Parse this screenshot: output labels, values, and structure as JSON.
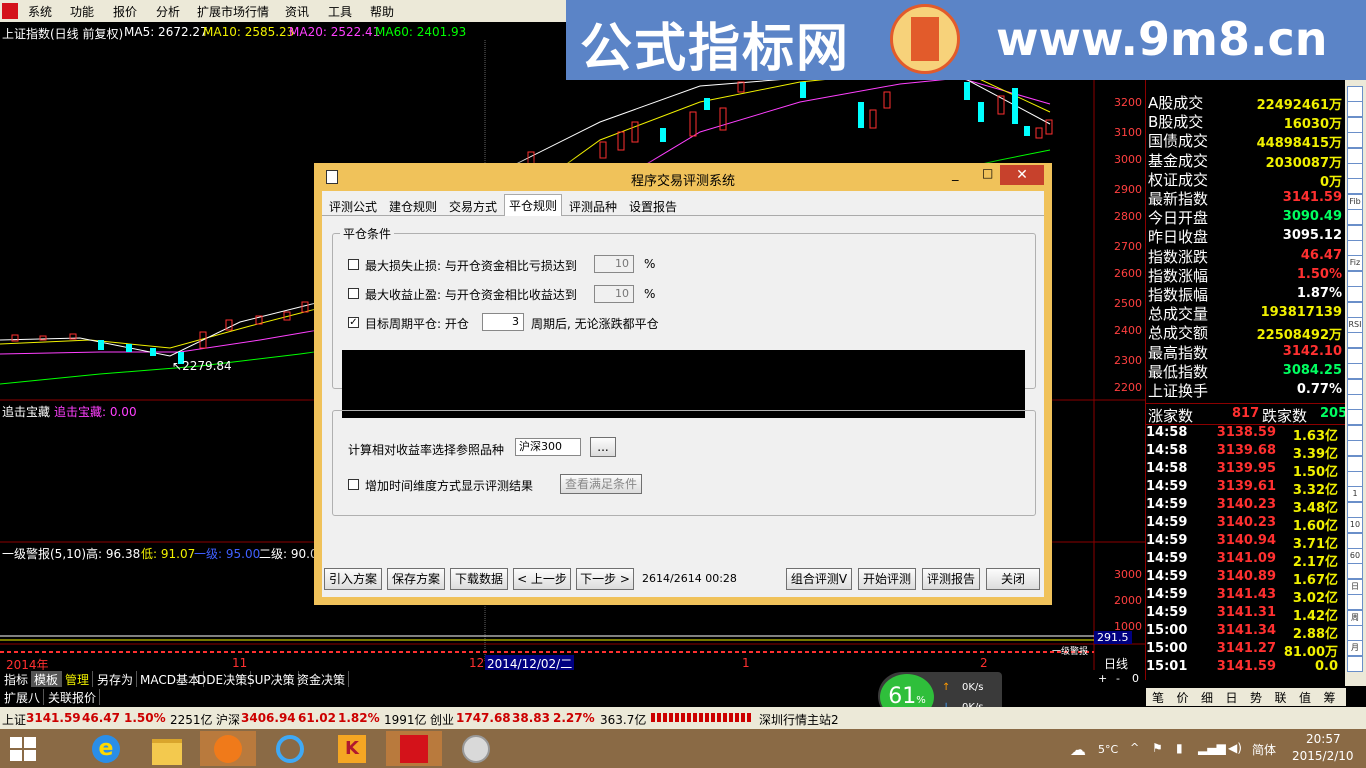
{
  "menubar": {
    "items": [
      "系统",
      "功能",
      "报价",
      "分析",
      "扩展市场行情",
      "资讯",
      "工具",
      "帮助"
    ]
  },
  "banner": {
    "text": "公式指标网",
    "url": "www.9m8.cn"
  },
  "chart": {
    "title": "上证指数(日线 前复权)",
    "ma5": "MA5: 2672.27",
    "ma10": "MA10: 2585.23",
    "ma20": "MA20: 2522.41",
    "ma60": "MA60: 2401.93",
    "low_marker": "2279.84",
    "price_axis": [
      "3200",
      "3100",
      "3000",
      "2900",
      "2800",
      "2700",
      "2600",
      "2500",
      "2400",
      "2300",
      "2200"
    ],
    "lower_axis": [
      "3000",
      "2000",
      "1000"
    ],
    "indicator1_name": "追击宝藏",
    "indicator1_value": "追击宝藏: 0.00",
    "indicator2_name": "一级警报(5,10)",
    "indicator2_high": "高: 96.38",
    "indicator2_low": "低: 91.07",
    "indicator2_l1": "一级: 95.00",
    "indicator2_l2": "二级: 90.0",
    "vol_label": "291.5",
    "level_tag": "一级警报",
    "time_axis": [
      "2014年",
      "11",
      "12",
      "2014/12/02/二",
      "1",
      "2"
    ],
    "period": "日线",
    "colors": {
      "ma5": "#ffffff",
      "ma10": "#f0f000",
      "ma20": "#ff40ff",
      "ma60": "#00ff00",
      "up": "#ff3030",
      "down": "#00ffff"
    }
  },
  "right_panel": {
    "stats": [
      {
        "label": "A股成交",
        "value": "22492461万",
        "color": "yel"
      },
      {
        "label": "B股成交",
        "value": "16030万",
        "color": "yel"
      },
      {
        "label": "国债成交",
        "value": "44898415万",
        "color": "yel"
      },
      {
        "label": "基金成交",
        "value": "2030087万",
        "color": "yel"
      },
      {
        "label": "权证成交",
        "value": "0万",
        "color": "yel"
      },
      {
        "label": "最新指数",
        "value": "3141.59",
        "color": "red"
      },
      {
        "label": "今日开盘",
        "value": "3090.49",
        "color": "grn"
      },
      {
        "label": "昨日收盘",
        "value": "3095.12",
        "color": "wht"
      },
      {
        "label": "指数涨跌",
        "value": "46.47",
        "color": "red"
      },
      {
        "label": "指数涨幅",
        "value": "1.50%",
        "color": "red"
      },
      {
        "label": "指数振幅",
        "value": "1.87%",
        "color": "wht"
      },
      {
        "label": "总成交量",
        "value": "193817139",
        "color": "yel"
      },
      {
        "label": "总成交额",
        "value": "22508492万",
        "color": "yel"
      },
      {
        "label": "最高指数",
        "value": "3142.10",
        "color": "red"
      },
      {
        "label": "最低指数",
        "value": "3084.25",
        "color": "grn"
      },
      {
        "label": "上证换手",
        "value": "0.77%",
        "color": "wht"
      }
    ],
    "rise_label": "涨家数",
    "rise_count": "817",
    "fall_label": "跌家数",
    "fall_count": "205",
    "ticks": [
      {
        "time": "14:58",
        "price": "3138.59",
        "vol": "1.63亿"
      },
      {
        "time": "14:58",
        "price": "3139.68",
        "vol": "3.39亿"
      },
      {
        "time": "14:58",
        "price": "3139.95",
        "vol": "1.50亿"
      },
      {
        "time": "14:59",
        "price": "3139.61",
        "vol": "3.32亿"
      },
      {
        "time": "14:59",
        "price": "3140.23",
        "vol": "3.48亿"
      },
      {
        "time": "14:59",
        "price": "3140.23",
        "vol": "1.60亿"
      },
      {
        "time": "14:59",
        "price": "3140.94",
        "vol": "3.71亿"
      },
      {
        "time": "14:59",
        "price": "3141.09",
        "vol": "2.17亿"
      },
      {
        "time": "14:59",
        "price": "3140.89",
        "vol": "1.67亿"
      },
      {
        "time": "14:59",
        "price": "3141.43",
        "vol": "3.02亿"
      },
      {
        "time": "14:59",
        "price": "3141.31",
        "vol": "1.42亿"
      },
      {
        "time": "15:00",
        "price": "3141.34",
        "vol": "2.88亿"
      },
      {
        "time": "15:00",
        "price": "3141.27",
        "vol": "81.00万"
      },
      {
        "time": "15:01",
        "price": "3141.59",
        "vol": "0.0"
      }
    ],
    "bottom_tabs": [
      "笔",
      "价",
      "细",
      "日",
      "势",
      "联",
      "值",
      "筹"
    ]
  },
  "right_toolbar": {
    "labels": [
      "",
      "",
      "",
      "",
      "",
      "",
      "",
      "Fib",
      "",
      "",
      "",
      "Fiz",
      "",
      "",
      "",
      "RSI",
      "",
      "",
      "",
      "",
      "",
      "",
      "",
      "",
      "",
      "",
      "1",
      "",
      "10",
      "",
      "60",
      "",
      "日",
      "",
      "周",
      "",
      "月",
      ""
    ]
  },
  "bottom_tabs": {
    "row1": [
      "指标",
      "模板",
      "管理",
      "另存为",
      "MACD基本",
      "DDE决策",
      "SUP决策",
      "资金决策"
    ],
    "row2": [
      "扩展八",
      "关联报价"
    ],
    "corner": [
      "+",
      "-",
      "0"
    ]
  },
  "status_bar": {
    "sh_name": "上证",
    "sh_price": "3141.59",
    "sh_change": "46.47",
    "sh_pct": "1.50%",
    "sh_amount": "2251亿",
    "sz_name": "沪深",
    "sz_price": "3406.94",
    "sz_change": "61.02",
    "sz_pct": "1.82%",
    "sz_amount": "1991亿",
    "cy_name": "创业",
    "cy_price": "1747.68",
    "cy_change": "38.83",
    "cy_pct": "2.27%",
    "cy_amount": "363.7亿",
    "server": "深圳行情主站2"
  },
  "speed_widget": {
    "percent": "61",
    "pct_sign": "%",
    "up": "0K/s",
    "down": "0K/s"
  },
  "taskbar": {
    "weather": "5°C",
    "ime": "简体",
    "time": "20:57",
    "date": "2015/2/10"
  },
  "dialog": {
    "title": "程序交易评测系统",
    "minimize": "_",
    "maximize": "□",
    "close": "✕",
    "tabs": [
      "评测公式",
      "建仓规则",
      "交易方式",
      "平仓规则",
      "评测品种",
      "设置报告"
    ],
    "active_tab": 3,
    "group1_label": "平仓条件",
    "stop_loss_label": "最大损失止损: 与开仓资金相比亏损达到",
    "stop_loss_value": "10",
    "stop_loss_unit": "%",
    "take_profit_label": "最大收益止盈: 与开仓资金相比收益达到",
    "take_profit_value": "10",
    "take_profit_unit": "%",
    "period_label": "目标周期平仓: 开仓",
    "period_value": "3",
    "period_suffix": "周期后, 无论涨跌都平仓",
    "period_checked": "✓",
    "benchmark_label": "计算相对收益率选择参照品种",
    "benchmark_value": "沪深300",
    "browse_label": "...",
    "time_dim_label": "增加时间维度方式显示评测结果",
    "view_cond_label": "查看满足条件",
    "footer": {
      "import": "引入方案",
      "save": "保存方案",
      "download": "下载数据",
      "prev": "< 上一步",
      "next": "下一步 >",
      "progress": "2614/2614 00:28",
      "combo": "组合评测V",
      "start": "开始评测",
      "report": "评测报告",
      "closebtn": "关闭"
    }
  }
}
